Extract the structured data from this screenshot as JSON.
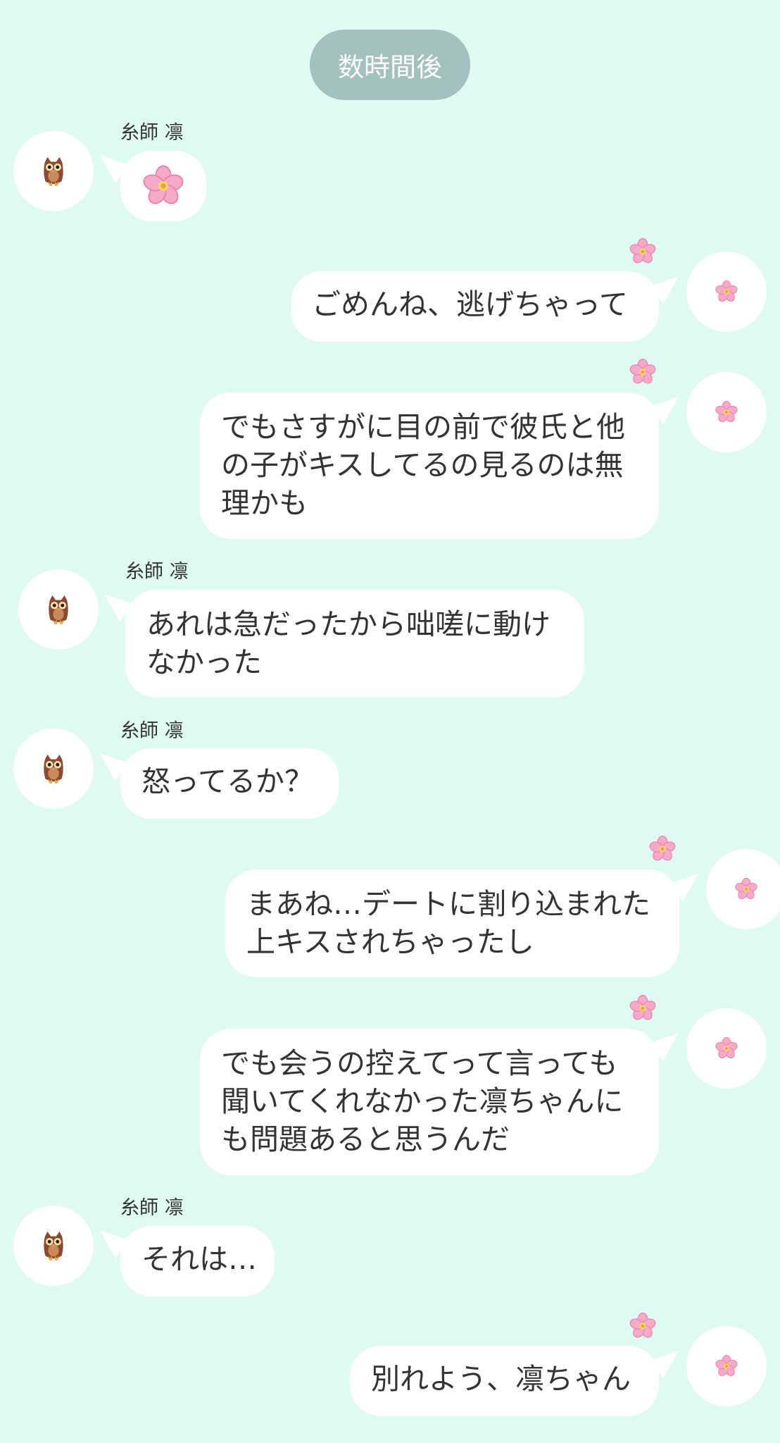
{
  "time_divider": "数時間後",
  "messages": [
    {
      "side": "left",
      "name": "糸師 凛",
      "text": "",
      "sticker": "cherry-blossom"
    },
    {
      "side": "right",
      "text": "ごめんね、逃げちゃって"
    },
    {
      "side": "right",
      "text": "でもさすがに目の前で彼氏と他\nの子がキスしてるの見るのは無\n理かも"
    },
    {
      "side": "left",
      "name": "糸師 凛",
      "text": "あれは急だったから咄嗟に動け\nなかった"
    },
    {
      "side": "left",
      "name": "糸師 凛",
      "text": "怒ってるか？"
    },
    {
      "side": "right",
      "text": "まあね…デートに割り込まれた\n上キスされちゃったし"
    },
    {
      "side": "right",
      "text": "でも会うの控えてって言っても\n聞いてくれなかった凛ちゃんに\nも問題あると思うんだ"
    },
    {
      "side": "left",
      "name": "糸師 凛",
      "text": "それは…"
    },
    {
      "side": "right",
      "text": "別れよう、凛ちゃん"
    }
  ],
  "icons": {
    "left_avatar": "owl-icon",
    "right_avatar": "cherry-blossom-icon",
    "right_name_marker": "cherry-blossom-icon"
  },
  "colors": {
    "background": "#dff9f3",
    "bubble": "#ffffff",
    "time_pill": "#a4c1bf",
    "text": "#333333"
  }
}
